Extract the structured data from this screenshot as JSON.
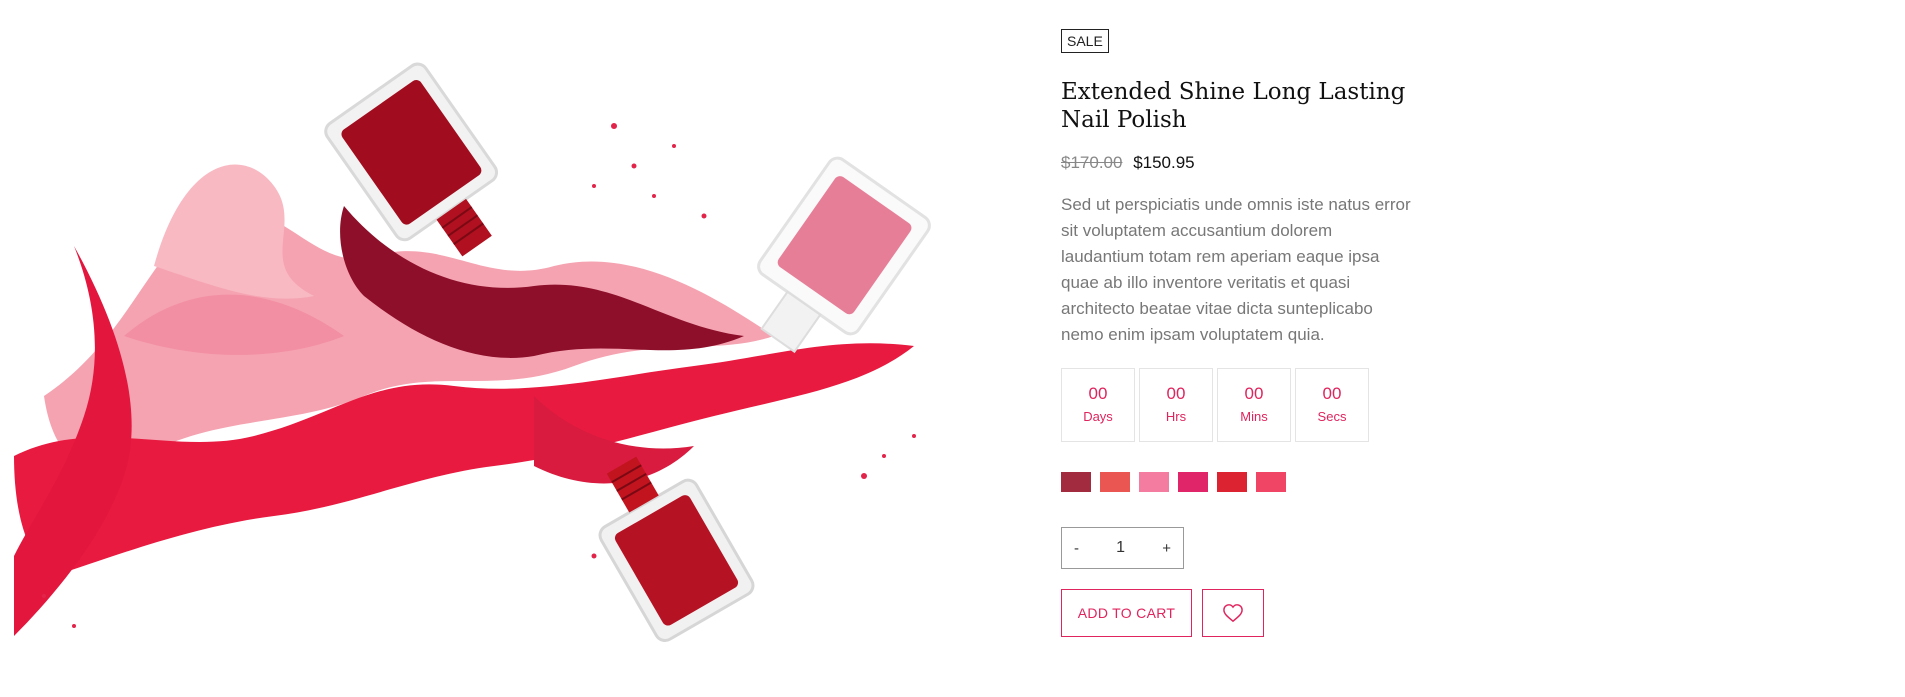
{
  "product": {
    "badge": "SALE",
    "title": "Extended Shine Long Lasting Nail Polish",
    "old_price": "$170.00",
    "price": "$150.95",
    "description": "Sed ut perspiciatis unde omnis iste natus error sit voluptatem accusantium dolorem laudantium totam rem aperiam eaque ipsa quae ab illo inventore veritatis et quasi architecto beatae vitae dicta sunteplicabo nemo enim ipsam voluptatem quia.",
    "image_icon": "nail-polish-splash-image"
  },
  "countdown": [
    {
      "value": "00",
      "label": "Days"
    },
    {
      "value": "00",
      "label": "Hrs"
    },
    {
      "value": "00",
      "label": "Mins"
    },
    {
      "value": "00",
      "label": "Secs"
    }
  ],
  "swatches": [
    "#a32b3f",
    "#ea5753",
    "#f37ca0",
    "#e02568",
    "#dc2332",
    "#f04565"
  ],
  "quantity": {
    "minus": "-",
    "value": "1",
    "plus": "+"
  },
  "actions": {
    "add_to_cart": "ADD TO CART",
    "wishlist_icon": "heart-icon"
  },
  "colors": {
    "accent": "#e0245e",
    "text": "#222222",
    "muted": "#777777"
  }
}
